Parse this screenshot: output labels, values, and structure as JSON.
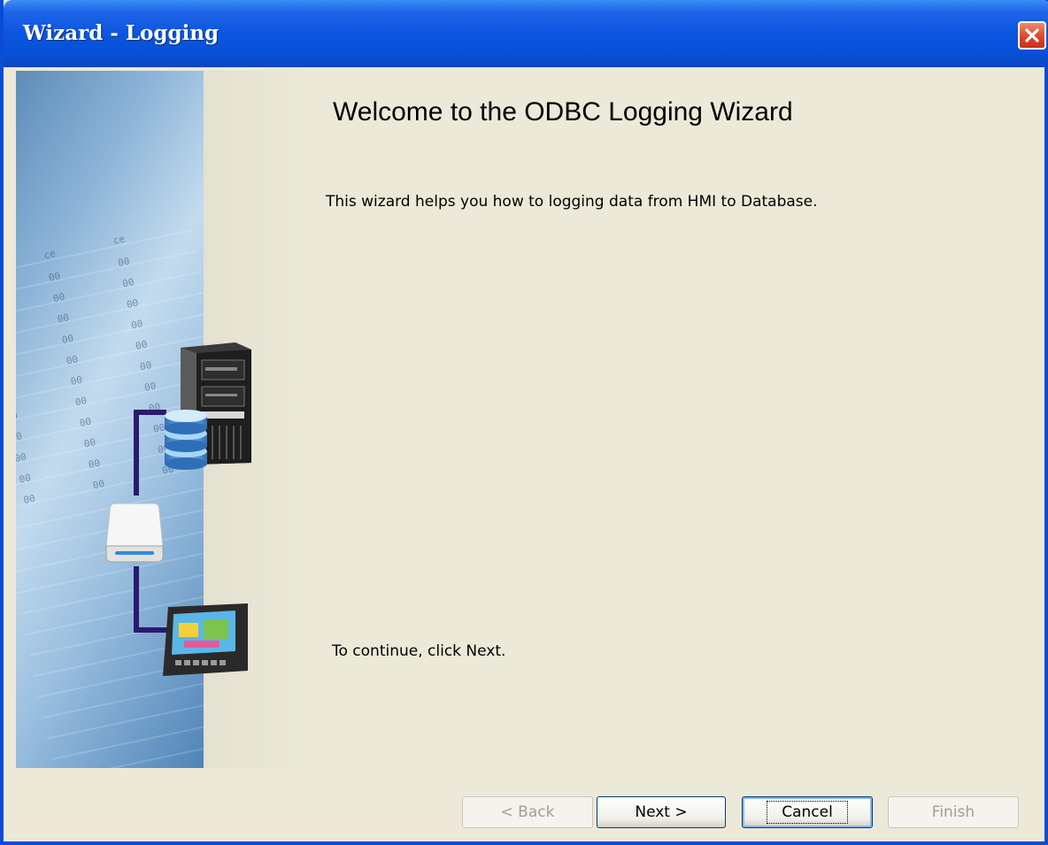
{
  "window": {
    "title": "Wizard - Logging"
  },
  "content": {
    "heading": "Welcome to the ODBC Logging Wizard",
    "description": "This wizard helps you how to logging data from HMI to Database.",
    "continue_text": "To continue, click Next."
  },
  "buttons": {
    "back": "< Back",
    "next": "Next >",
    "cancel": "Cancel",
    "finish": "Finish"
  },
  "side_image": {
    "icons": [
      "server-icon",
      "database-icon",
      "drive-icon",
      "hmi-panel-icon"
    ]
  },
  "colors": {
    "titlebar": "#0850D6",
    "window_bg": "#ECE9D8",
    "connector": "#2B1A6E",
    "close_button": "#D9432A"
  }
}
